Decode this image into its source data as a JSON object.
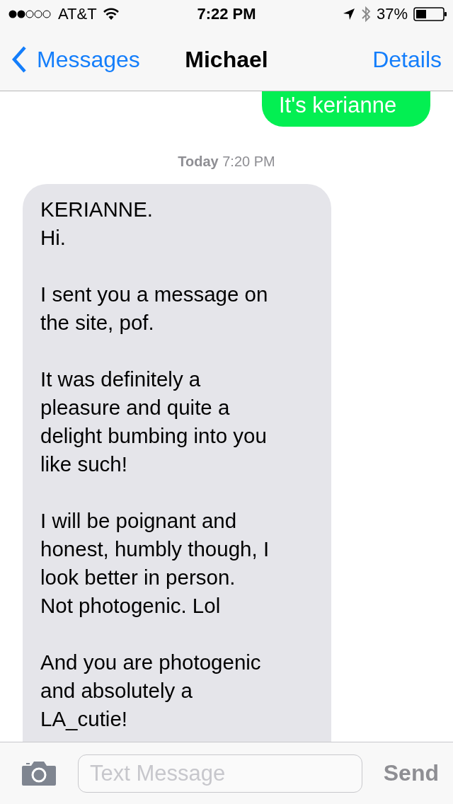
{
  "status_bar": {
    "carrier": "AT&T",
    "time": "7:22 PM",
    "battery": "37%"
  },
  "nav": {
    "back": "Messages",
    "title": "Michael",
    "action": "Details"
  },
  "messages": [
    {
      "kind": "outgoing",
      "paragraphs": [
        [
          "It's kerianne"
        ]
      ]
    },
    {
      "kind": "timestamp",
      "day": "Today",
      "time": "7:20 PM"
    },
    {
      "kind": "incoming",
      "paragraphs": [
        [
          "KERIANNE.",
          "Hi."
        ],
        [
          "I sent you a message on",
          "the site, pof."
        ],
        [
          "It was definitely a",
          "pleasure and quite a",
          "delight bumbing into you",
          "like such!"
        ],
        [
          "I will be poignant and",
          "honest, humbly though, I",
          "look better in person.",
          "Not photogenic. Lol"
        ],
        [
          "And you are photogenic",
          "and absolutely a",
          "LA_cutie!"
        ]
      ]
    }
  ],
  "composer": {
    "placeholder": "Text Message",
    "send": "Send"
  }
}
